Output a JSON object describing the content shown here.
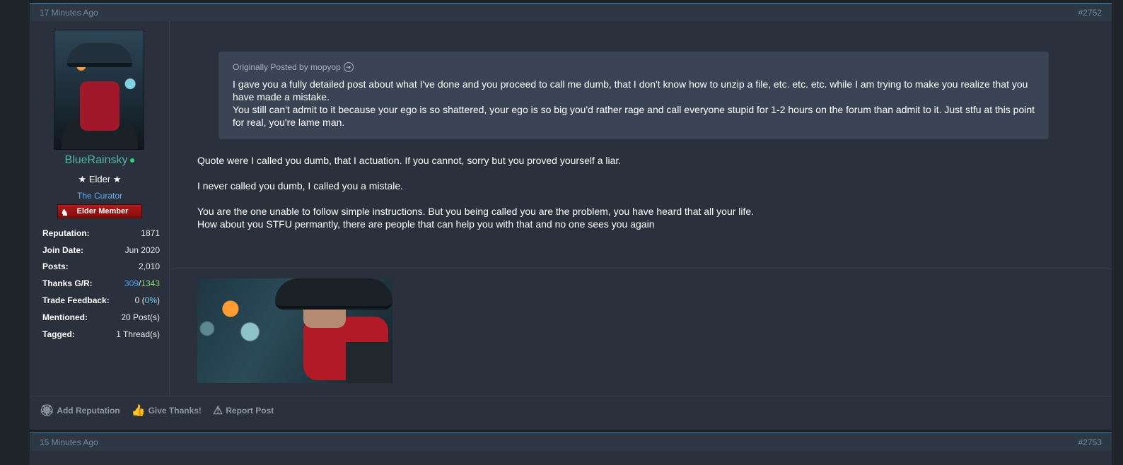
{
  "posts": [
    {
      "time": "17 Minutes Ago",
      "number": "#2752",
      "user": {
        "name": "BlueRainsky",
        "title": "★ Elder ★",
        "group": "The Curator",
        "badge": "Elder Member",
        "stats": [
          {
            "label": "Reputation:",
            "value": "1871"
          },
          {
            "label": "Join Date:",
            "value": "Jun 2020"
          },
          {
            "label": "Posts:",
            "value": "2,010"
          },
          {
            "label": "Thanks G/R:",
            "given": "309",
            "sep": "/",
            "received": "1343"
          },
          {
            "label": "Trade Feedback:",
            "pre": "0 (",
            "pct": "0%",
            "post": ")"
          },
          {
            "label": "Mentioned:",
            "value": "20 Post(s)"
          },
          {
            "label": "Tagged:",
            "value": "1 Thread(s)"
          }
        ]
      },
      "quote": {
        "header": "Originally Posted by mopyop",
        "lines": [
          "I gave you a fully detailed post about what I've done and you proceed to call me dumb, that I don't know how to unzip a file, etc. etc. etc. while I am trying to make you realize that you have made a mistake.",
          "You still can't admit to it because your ego is so shattered, your ego is so big you'd rather rage and call everyone stupid for 1-2 hours on the forum than admit to it. Just stfu at this point for real, you're lame man."
        ]
      },
      "message": [
        "Quote were I called you dumb, that I actuation. If you cannot, sorry but you proved yourself a liar.",
        "I never called you dumb, I called you a mistale.",
        "You are the one unable to follow simple instructions. But you being called you are the problem, you have heard that all your life.",
        "How about you STFU permantly, there are people that can help you with that and no one sees you again"
      ],
      "actions": [
        "Add Reputation",
        "Give Thanks!",
        "Report Post"
      ]
    },
    {
      "time": "15 Minutes Ago",
      "number": "#2753"
    }
  ]
}
